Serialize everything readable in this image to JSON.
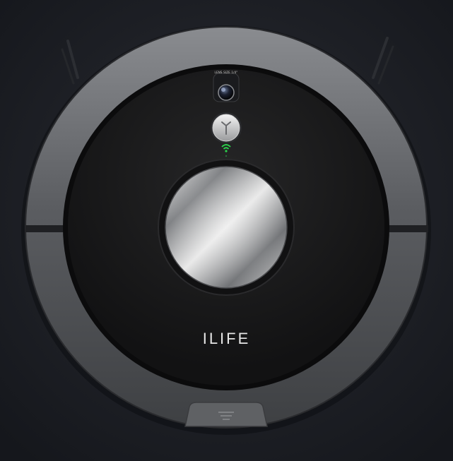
{
  "product": {
    "brand": "ILIFE",
    "camera_lens_text": "LENS SIZE 1/4\""
  },
  "colors": {
    "background": "#1d1f25",
    "bumper": "#6a6c70",
    "top_cover": "#1a1a1b",
    "wifi_indicator": "#2bd14a"
  },
  "icons": {
    "camera": "camera-lens-icon",
    "button": "power-button-icon",
    "wifi": "wifi-icon",
    "front_vent": "vent-lines-icon"
  }
}
